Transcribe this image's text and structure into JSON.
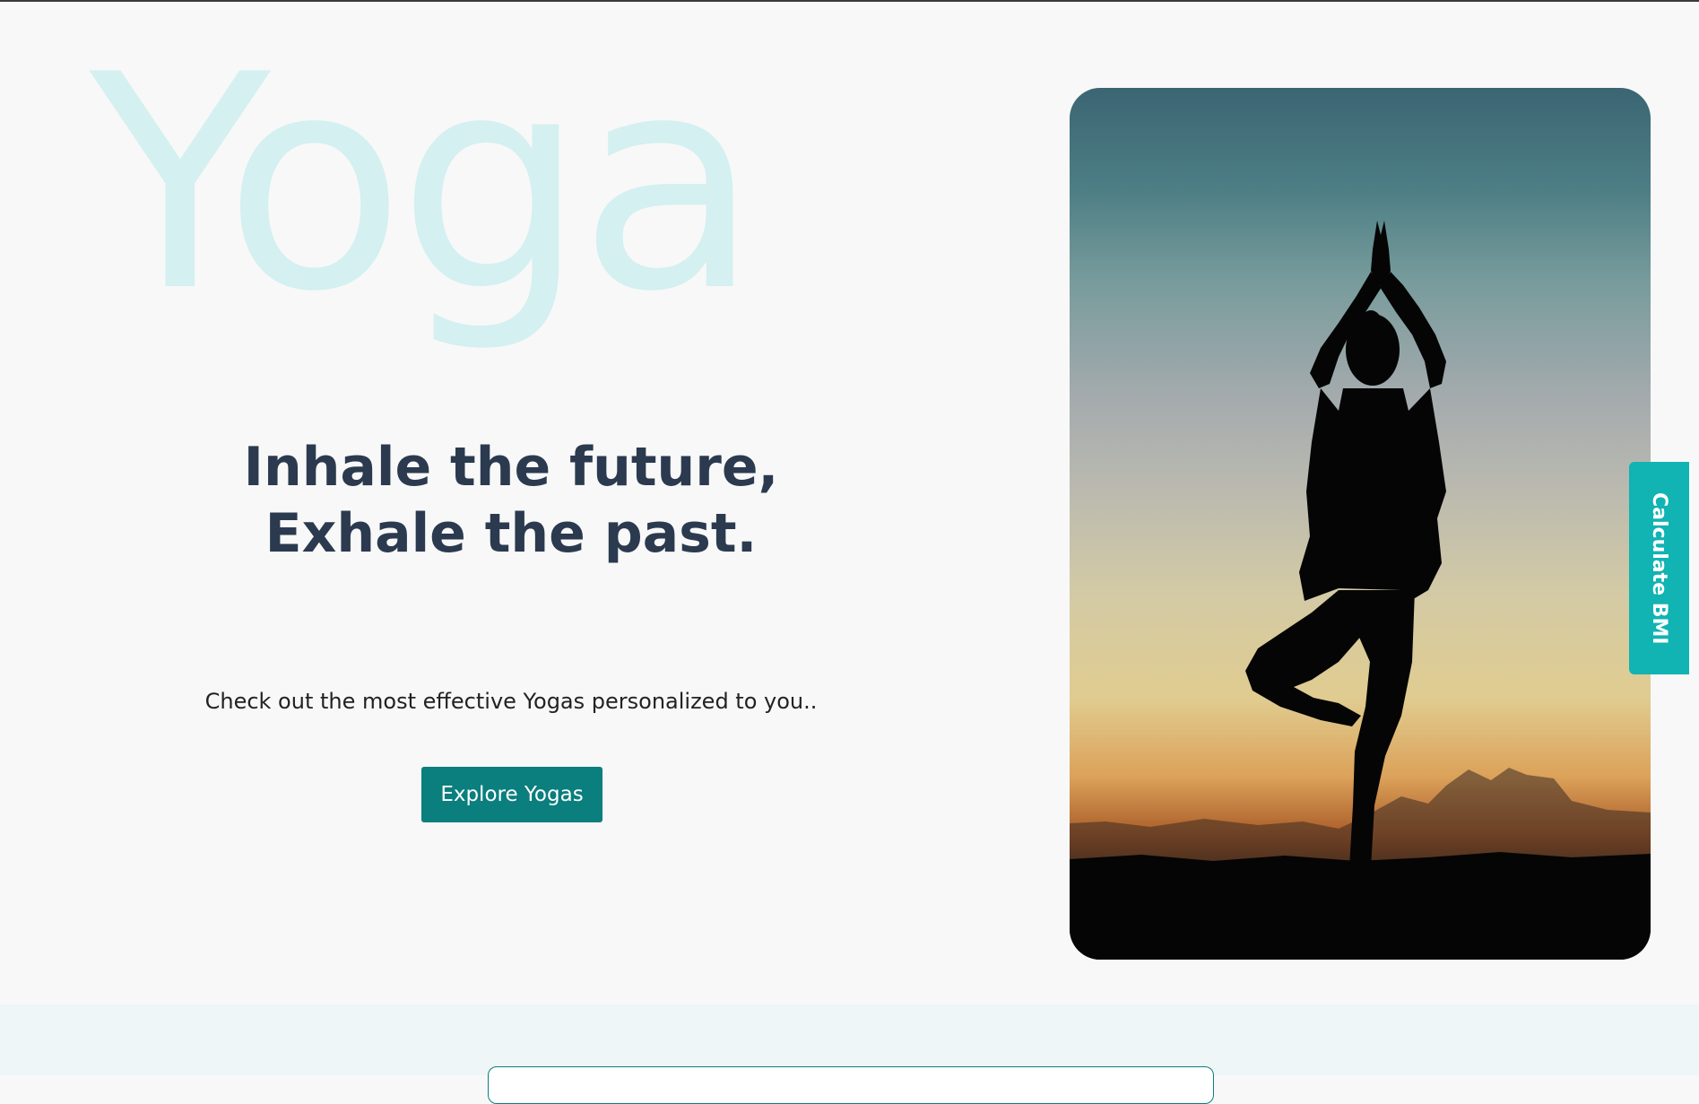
{
  "hero": {
    "background_word": "Yoga",
    "tagline_line1": "Inhale the future,",
    "tagline_line2": "Exhale the past.",
    "subtitle": "Check out the most effective Yogas personalized to you..",
    "explore_button_label": "Explore Yogas",
    "image_icon": "yoga-tree-pose-silhouette"
  },
  "bmi_tab": {
    "label": "Calculate BMI"
  },
  "colors": {
    "background": "#f8f8f8",
    "background_word": "#d4f0f0",
    "heading": "#2b3a4f",
    "button": "#0b7e7e",
    "bmi_tab": "#11b3b3",
    "next_section": "#eef6f7"
  }
}
